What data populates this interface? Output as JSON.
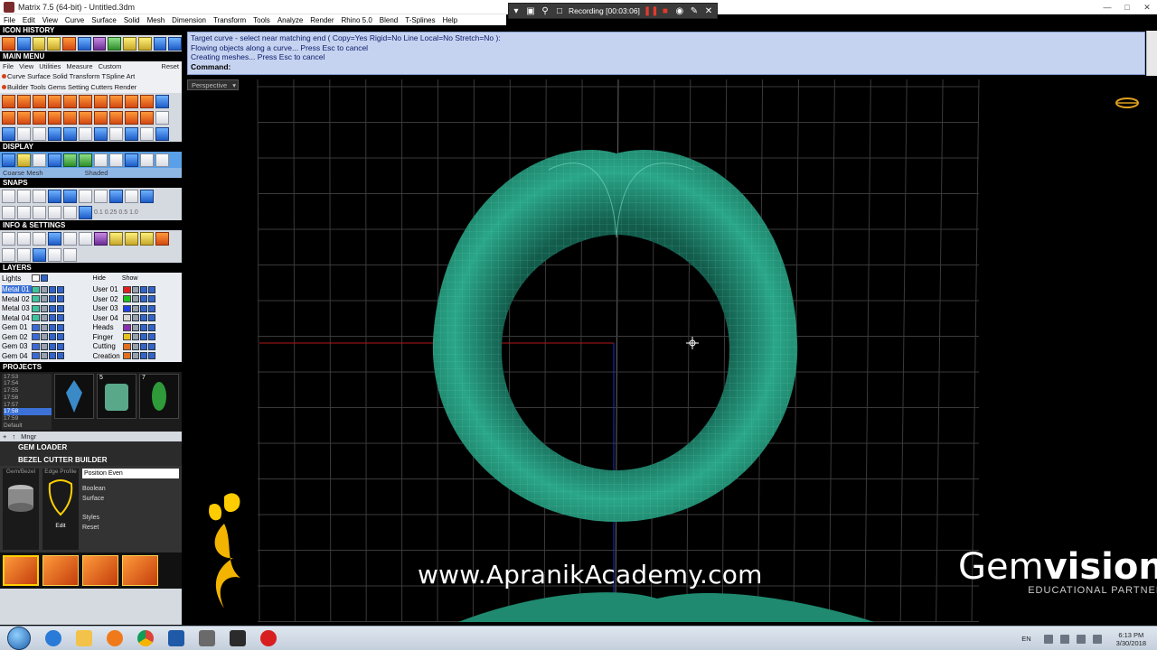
{
  "window": {
    "title": "Matrix 7.5 (64-bit) - Untitled.3dm"
  },
  "recorder": {
    "status_text": "Recording [00:03:06]"
  },
  "menu": {
    "items": [
      "File",
      "Edit",
      "View",
      "Curve",
      "Surface",
      "Solid",
      "Mesh",
      "Dimension",
      "Transform",
      "Tools",
      "Analyze",
      "Render",
      "Rhino 5.0",
      "Blend",
      "T-Splines",
      "Help"
    ]
  },
  "panel": {
    "icon_history": "ICON HISTORY",
    "main_menu": "MAIN MENU",
    "main_menu_links": [
      "File",
      "View",
      "Utilities",
      "Measure",
      "Custom"
    ],
    "main_menu_reset": "Reset",
    "main_tabs_row1": "Curve Surface Solid Transform TSpline Art",
    "main_tabs_row2": "Builder Tools Gems Setting Cutters Render",
    "display": "DISPLAY",
    "display_modes": [
      "Coarse Mesh",
      "Shaded"
    ],
    "snaps": "SNAPS",
    "snap_values": [
      "0.1",
      "0.25",
      "0.5",
      "1.0"
    ],
    "info_settings": "INFO & SETTINGS",
    "layers": "LAYERS",
    "layers_lights": "Lights",
    "layers_hide": "Hide",
    "layers_show": "Show",
    "layers_left": [
      "Metal 01",
      "Metal 02",
      "Metal 03",
      "Metal 04",
      "Gem 01",
      "Gem 02",
      "Gem 03",
      "Gem 04"
    ],
    "layers_right": [
      "User 01",
      "User 02",
      "User 03",
      "User 04",
      "Heads",
      "Finger",
      "Cutting",
      "Creation"
    ],
    "layer_colors_left": [
      "#3cc4a0",
      "#3cc4a0",
      "#3cc4a0",
      "#3cc4a0",
      "#3a6ad8",
      "#3a6ad8",
      "#3a6ad8",
      "#3a6ad8"
    ],
    "layer_colors_right": [
      "#e02020",
      "#20c020",
      "#2040e0",
      "#d8d8d8",
      "#8a2fb0",
      "#e8c020",
      "#e07020",
      "#e07020"
    ],
    "projects": "PROJECTS",
    "project_list": [
      "17:53",
      "17:54",
      "17:55",
      "17:56",
      "17:57",
      "17:58",
      "17:59",
      "Default"
    ],
    "project_thumb_numbers": [
      "",
      "5",
      "7"
    ],
    "projects_mngr": "Mngr",
    "gem_loader": "GEM LOADER",
    "bezel_cutter": "BEZEL CUTTER BUILDER",
    "bezel_gem_label": "Gem/Bezel",
    "bezel_edge_label": "Edge Profile",
    "bezel_edit": "Edit",
    "bezel_options": [
      "Position Even",
      "Boolean",
      "Surface",
      "Styles",
      "Reset"
    ]
  },
  "command": {
    "lines": [
      "Target curve - select near matching end ( Copy=Yes  Rigid=No  Line  Local=No  Stretch=No ):",
      "Flowing objects along a curve... Press Esc to cancel",
      "Creating meshes... Press Esc to cancel"
    ],
    "prompt": "Command:"
  },
  "viewport": {
    "label": "Perspective",
    "mesh_color": "#2aa688"
  },
  "overlay": {
    "website": "www.ApranikAcademy.com",
    "brand_gem": "Gem",
    "brand_vision": "vision",
    "brand_sub": "EDUCATIONAL PARTNER"
  },
  "taskbar": {
    "lang": "EN",
    "time": "6:13 PM",
    "date": "3/30/2018"
  }
}
